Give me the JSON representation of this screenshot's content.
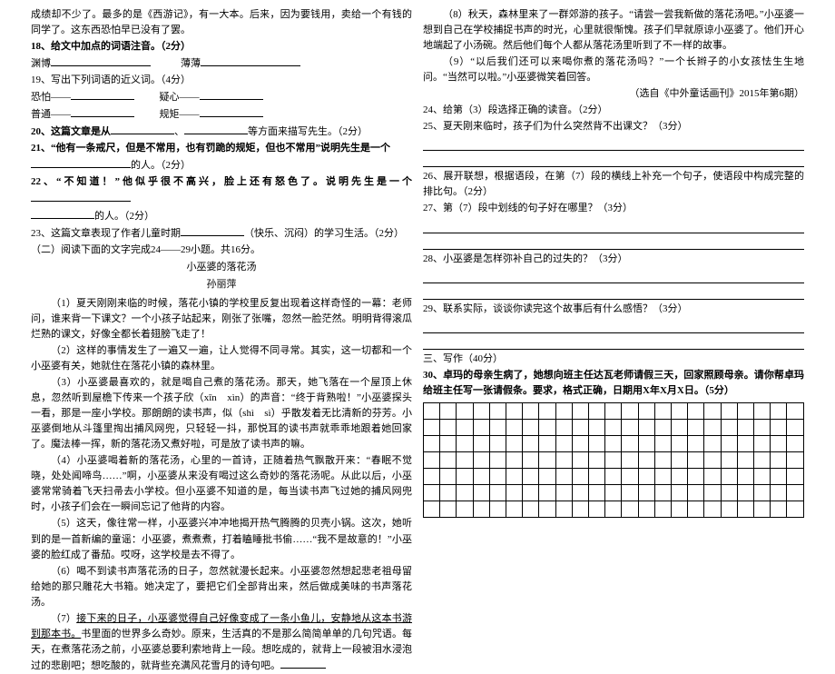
{
  "left": {
    "p1": "成绩却不少了。最多的是《西游记》，有一大本。后来，因为要钱用，卖给一个有钱的同学了。这东西恐怕早已没有了罢。",
    "q18": "18、给文中加点的词语注音。（2分）",
    "q18_a": "渊博",
    "q18_b": "薄薄",
    "q19": "19、写出下列词语的近义词。（4分）",
    "q19_a1": "恐怕——",
    "q19_a2": "疑心——",
    "q19_b1": "普通——",
    "q19_b2": "规矩——",
    "q20a": "20、这篇文章是从",
    "q20b": "、",
    "q20c": "等方面来描写先生。（2分）",
    "q21a": "21、“他有一条戒尺，但是不常用，也有罚跪的规矩，但也不常用”说明先生是一个",
    "q21b": "的人。（2分）",
    "q22a": "22、“不知道！”他似乎很不高兴，脸上还有怒色了。说明先生是一个",
    "q22b": "的人。（2分）",
    "q23a": "23、这篇文章表现了作者儿童时期",
    "q23b": "（快乐、沉闷）的学习生活。（2分）",
    "sec2": "（二）阅读下面的文字完成24——29小题。共16分。",
    "title": "小巫婆的落花汤",
    "author": "孙丽萍",
    "s1": "（1）夏天刚刚来临的时候，落花小镇的学校里反复出现着这样奇怪的一幕：老师问，谁来背一下课文？一个小孩子站起来，刚张了张嘴，忽然一脸茫然。明明背得滚瓜烂熟的课文，好像全都长着翅膀飞走了！",
    "s2": "（2）这样的事情发生了一遍又一遍，让人觉得不同寻常。其实，这一切都和一个小巫婆有关，她就住在落花小镇的森林里。",
    "s3": "（3）小巫婆最喜欢的，就是喝自己煮的落花汤。那天，她飞落在一个屋顶上休息，忽然听到屋檐下传来一个孩子欣（xīn　xìn）的声音：“终于背熟啦！”小巫婆探头一看，那是一座小学校。那朗朗的读书声，似（shì　sì）乎散发着无比清新的芬芳。小巫婆倒地从斗篷里掏出捕风网兜，只轻轻一抖，那悦耳的读书声就乖乖地跟着她回家了。魔法棒一挥，新的落花汤又煮好啦，可是放了读书声的嘛。",
    "s4": "（4）小巫婆喝着新的落花汤，心里的一首诗，正随着热气飘散开来：“春眠不觉晓，处处闻啼鸟……”啊，小巫婆从来没有喝过这么奇妙的落花汤呢。从此以后，小巫婆常常骑着飞天扫帚去小学校。但小巫婆不知道的是，每当读书声飞过她的捕风网兜时，小孩子们会在一瞬间忘记了他背的内容。",
    "s5": "（5）这天，像往常一样，小巫婆兴冲冲地揭开热气腾腾的贝壳小锅。这次，她听到的是一首新编的童谣：小巫婆，煮煮煮，打着瞌睡批书偷……“我不是故意的！”小巫婆的脸红成了番茄。哎呀，这学校是去不得了。",
    "s6": "（6）喝不到读书声落花汤的日子，忽然就漫长起来。小巫婆忽然想起悲老祖母留给她的那只雕花大书箱。她决定了，要把它们全部背出来，然后做成美味的书声落花汤。",
    "s7a": "（7）",
    "s7u": "接下来的日子，小巫婆觉得自己好像变成了一条小鱼儿，安静地从这本书游到那本书。",
    "s7b": "书里面的世界多么奇妙。原来，生活真的不是那么简简单单的几句咒语。每天，在煮落花汤之前，小巫婆总要利索地背上一段。想吃成的，就背上一段被泪水浸泡过的悲剧吧；想吃酸的，就背些充满风花雪月的诗句吧。"
  },
  "right": {
    "s8": "（8）秋天，森林里来了一群郊游的孩子。“请尝一尝我新做的落花汤吧。”小巫婆一想到自己在学校捕捉书声的时光，心里就很惭愧。孩子们早就原谅小巫婆了。他们开心地端起了小汤碗。然后他们每个人都从落花汤里听到了不一样的故事。",
    "s9": "（9）“以后我们还可以来喝你煮的落花汤吗？”一个长辫子的小女孩怯生生地问。“当然可以啦。”小巫婆微笑着回答。",
    "src": "（选自《中外童话画刊》2015年第6期）",
    "q24": "24、给第（3）段选择正确的读音。（2分）",
    "q25": "25、夏天刚来临时，孩子们为什么突然背不出课文？（3分）",
    "q26": "26、展开联想，根据语段，在第（7）段的横线上补充一个句子，使语段中构成完整的排比句。（2分）",
    "q27": "27、第（7）段中划线的句子好在哪里？（3分）",
    "q28": "28、小巫婆是怎样弥补自己的过失的？（3分）",
    "q29": "29、联系实际，谈谈你读完这个故事后有什么感悟？（3分）",
    "sec3": "三、写作（40分）",
    "q30": "30、卓玛的母亲生病了，她想向班主任达瓦老师请假三天，回家照顾母亲。请你帮卓玛给班主任写一张请假条。要求，格式正确，日期用X年X月X日。（5分）"
  }
}
